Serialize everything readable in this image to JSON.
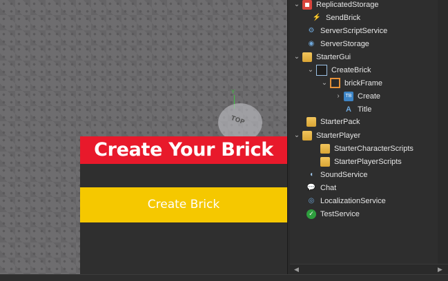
{
  "viewport": {
    "gui_title": "Create Your Brick",
    "create_button": "Create Brick",
    "gizmo_label": "TOP",
    "gizmo_axis": "Y",
    "colors": {
      "title_bg": "#e8192b",
      "button_bg": "#f5c800",
      "frame_bg": "#2f2f2f"
    }
  },
  "explorer": {
    "items": [
      {
        "label": "ReplicatedStorage",
        "arrow": "⌄",
        "icon": "replicated-storage-icon"
      },
      {
        "label": "SendBrick",
        "arrow": "",
        "icon": "remote-event-icon"
      },
      {
        "label": "ServerScriptService",
        "arrow": "",
        "icon": "server-script-service-icon"
      },
      {
        "label": "ServerStorage",
        "arrow": "",
        "icon": "server-storage-icon"
      },
      {
        "label": "StarterGui",
        "arrow": "⌄",
        "icon": "starter-gui-icon"
      },
      {
        "label": "CreateBrick",
        "arrow": "⌄",
        "icon": "screen-gui-icon"
      },
      {
        "label": "brickFrame",
        "arrow": "⌄",
        "icon": "frame-icon"
      },
      {
        "label": "Create",
        "arrow": "›",
        "icon": "text-button-icon"
      },
      {
        "label": "Title",
        "arrow": "",
        "icon": "text-label-icon"
      },
      {
        "label": "StarterPack",
        "arrow": "",
        "icon": "starter-pack-icon"
      },
      {
        "label": "StarterPlayer",
        "arrow": "⌄",
        "icon": "starter-player-icon"
      },
      {
        "label": "StarterCharacterScripts",
        "arrow": "",
        "icon": "folder-icon"
      },
      {
        "label": "StarterPlayerScripts",
        "arrow": "",
        "icon": "folder-icon"
      },
      {
        "label": "SoundService",
        "arrow": "",
        "icon": "sound-service-icon"
      },
      {
        "label": "Chat",
        "arrow": "",
        "icon": "chat-icon"
      },
      {
        "label": "LocalizationService",
        "arrow": "",
        "icon": "localization-icon"
      },
      {
        "label": "TestService",
        "arrow": "",
        "icon": "test-service-icon"
      }
    ]
  }
}
